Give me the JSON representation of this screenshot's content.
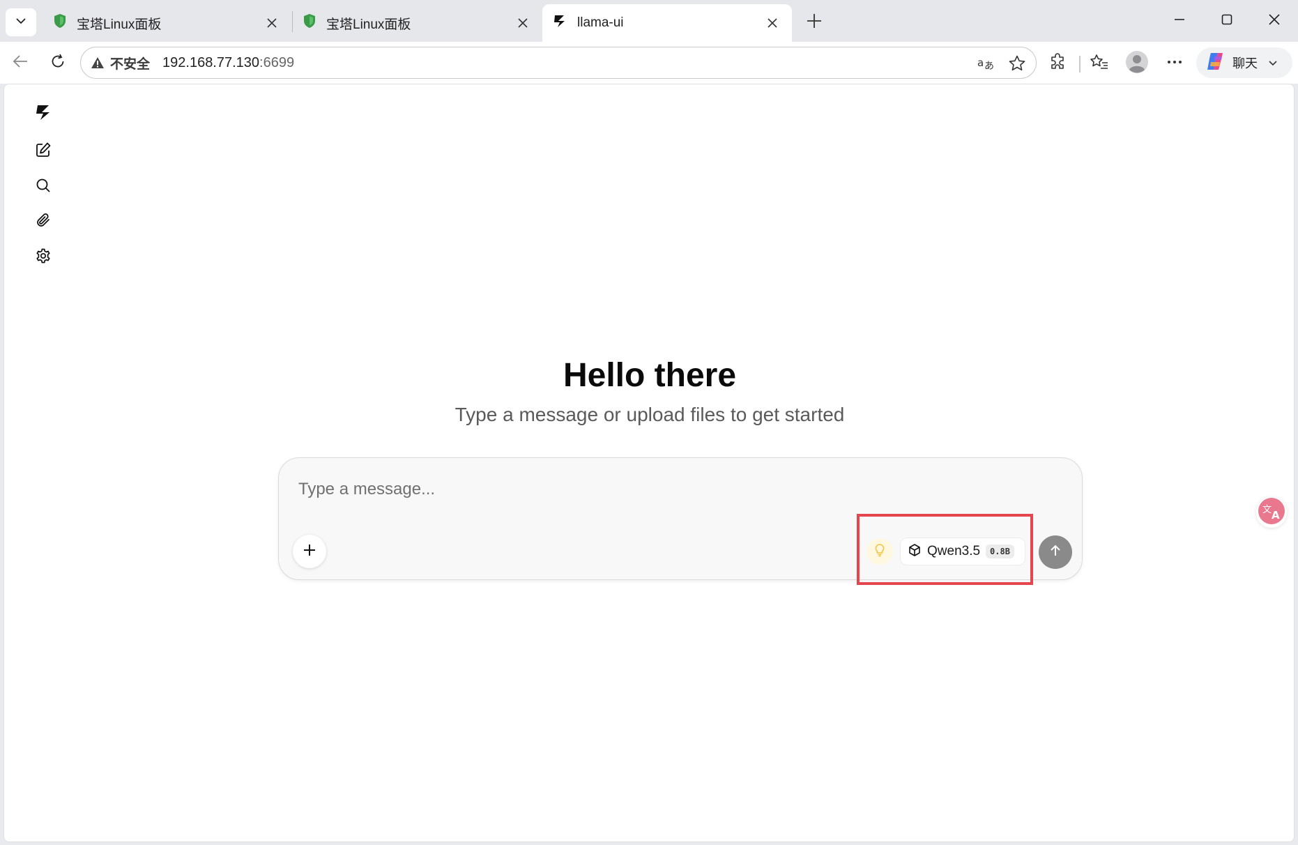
{
  "browser": {
    "tabs": [
      {
        "title": "宝塔Linux面板"
      },
      {
        "title": "宝塔Linux面板"
      },
      {
        "title": "llama-ui"
      }
    ],
    "address": {
      "security_label": "不安全",
      "host": "192.168.77.130",
      "port": ":6699"
    },
    "copilot_label": "聊天",
    "icons": {
      "tab_menu": "chevron-down-icon",
      "new_tab": "plus-icon",
      "back": "arrow-left-icon",
      "reload": "reload-icon",
      "warning": "warning-triangle-icon",
      "read_aloud": "translate-icon",
      "favorite": "star-icon",
      "extensions": "puzzle-icon",
      "favorites": "favorites-list-icon",
      "profile": "profile-icon",
      "more": "more-dots-icon"
    },
    "colors": {
      "tab_favicon": "#3a9a48",
      "highlight": "#e5454f"
    }
  },
  "app": {
    "sidebar": {
      "items": [
        {
          "name": "logo-icon"
        },
        {
          "name": "new-chat-icon"
        },
        {
          "name": "search-icon"
        },
        {
          "name": "attachment-icon"
        },
        {
          "name": "gear-icon"
        }
      ]
    },
    "hero": {
      "title": "Hello there",
      "subtitle": "Type a message or upload files to get started"
    },
    "composer": {
      "placeholder": "Type a message...",
      "model_name": "Qwen3.5",
      "model_size": "0.8B"
    }
  }
}
